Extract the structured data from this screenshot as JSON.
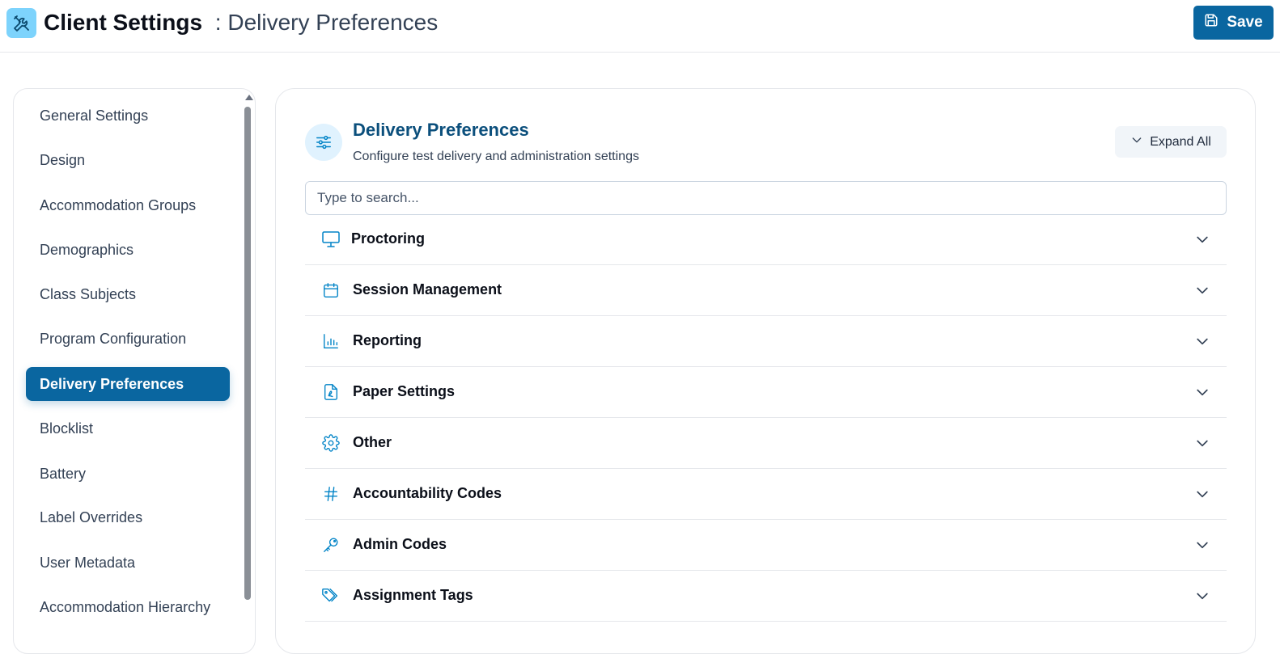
{
  "header": {
    "app_icon": "tools-icon",
    "title": "Client Settings",
    "separator": ":",
    "subtitle": "Delivery Preferences",
    "save_label": "Save"
  },
  "sidebar": {
    "items": [
      {
        "label": "General Settings",
        "active": false
      },
      {
        "label": "Design",
        "active": false
      },
      {
        "label": "Accommodation Groups",
        "active": false
      },
      {
        "label": "Demographics",
        "active": false
      },
      {
        "label": "Class Subjects",
        "active": false
      },
      {
        "label": "Program Configuration",
        "active": false
      },
      {
        "label": "Delivery Preferences",
        "active": true
      },
      {
        "label": "Blocklist",
        "active": false
      },
      {
        "label": "Battery",
        "active": false
      },
      {
        "label": "Label Overrides",
        "active": false
      },
      {
        "label": "User Metadata",
        "active": false
      },
      {
        "label": "Accommodation Hierarchy",
        "active": false
      }
    ]
  },
  "main": {
    "icon": "sliders-icon",
    "title": "Delivery Preferences",
    "description": "Configure test delivery and administration settings",
    "expand_label": "Expand All",
    "search_placeholder": "Type to search...",
    "sections": [
      {
        "label": "Proctoring",
        "icon": "monitor-icon"
      },
      {
        "label": "Session Management",
        "icon": "calendar-icon"
      },
      {
        "label": "Reporting",
        "icon": "bar-chart-icon"
      },
      {
        "label": "Paper Settings",
        "icon": "pdf-file-icon"
      },
      {
        "label": "Other",
        "icon": "gear-icon"
      },
      {
        "label": "Accountability Codes",
        "icon": "hash-icon"
      },
      {
        "label": "Admin Codes",
        "icon": "key-icon"
      },
      {
        "label": "Assignment Tags",
        "icon": "tags-icon"
      }
    ]
  },
  "colors": {
    "primary": "#0a66a0",
    "accent_icon": "#0284c7",
    "app_icon_bg": "#7dd3fc",
    "title_blue": "#0b4f7c"
  }
}
